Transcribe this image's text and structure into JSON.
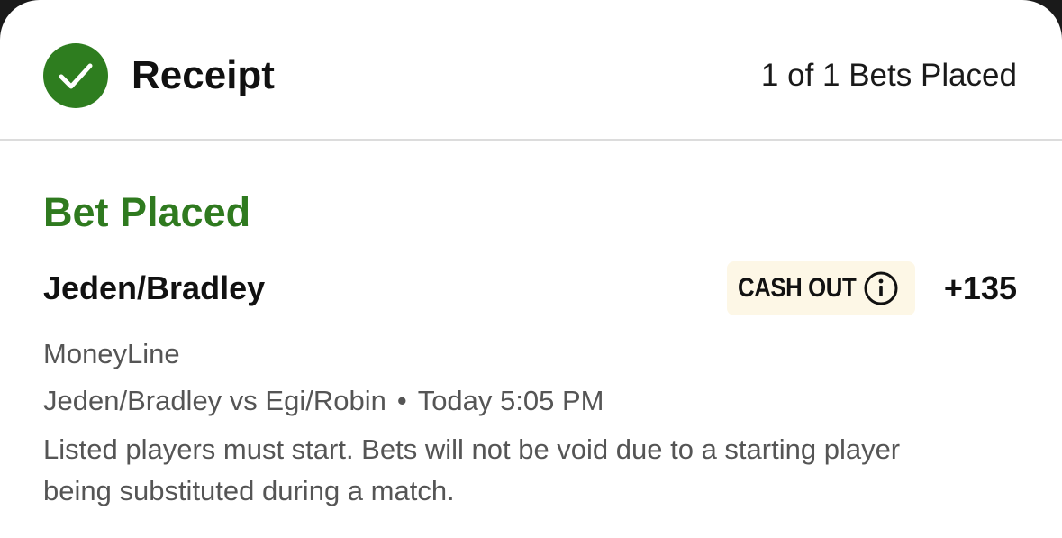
{
  "header": {
    "title": "Receipt",
    "bets_count": "1 of 1 Bets Placed",
    "status_icon": "check-icon"
  },
  "bet": {
    "status": "Bet Placed",
    "selection": "Jeden/Bradley",
    "cash_out_label": "CASH OUT",
    "info_icon": "info-icon",
    "odds": "+135",
    "market": "MoneyLine",
    "matchup": "Jeden/Bradley vs Egi/Robin",
    "separator": "•",
    "start_time": "Today 5:05 PM",
    "rules": "Listed players must start. Bets will not be void due to a starting player being substituted during a match."
  },
  "colors": {
    "brand_green": "#2e7d1f",
    "status_green": "#2f7a1f",
    "cash_out_bg": "#fdf7e6",
    "secondary_text": "#555555"
  }
}
